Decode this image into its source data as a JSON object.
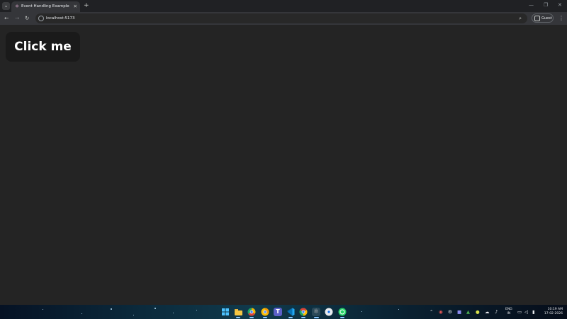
{
  "browser": {
    "tab_title": "Event Handling Example",
    "tab_favicon_icon": "react-logo-icon",
    "address_url": "localhost:5173",
    "profile_label": "Guest",
    "colors": {
      "frame": "#202124",
      "toolbar": "#35363a",
      "omnibox": "#282828"
    }
  },
  "page": {
    "background": "#242424",
    "button_label": "Click me",
    "button_background": "#1a1a1a"
  },
  "taskbar": {
    "apps": [
      "windows-start-icon",
      "file-explorer-icon",
      "chrome-dev-icon",
      "chrome-canary-icon",
      "teams-icon",
      "vscode-icon",
      "chrome-icon",
      "react-devtools-icon",
      "chrome-beta-icon",
      "whatsapp-icon"
    ],
    "tray": {
      "lang_line1": "ENG",
      "lang_line2": "IN",
      "time": "10:19 AM",
      "date": "17-02-2026"
    }
  }
}
